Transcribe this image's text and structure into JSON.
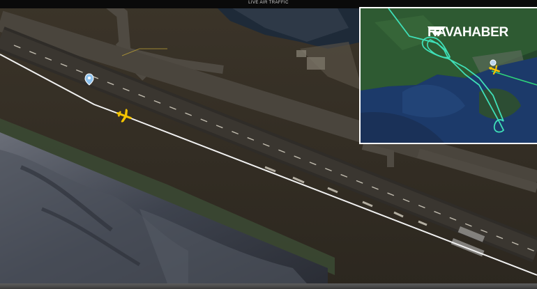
{
  "header": {
    "text": "LIVE AIR TRAFFIC"
  },
  "inset": {
    "brand": "HAVAHABER"
  },
  "colors": {
    "track_main": "#f2f2f2",
    "track_inset": "#3fe0b8",
    "track_inset_tail": "#2fd37a",
    "aircraft": "#f4c400",
    "marker": "#8fc3ee"
  },
  "icons": [
    "aircraft-icon",
    "location-pin-icon",
    "havahaber-logo-icon"
  ]
}
